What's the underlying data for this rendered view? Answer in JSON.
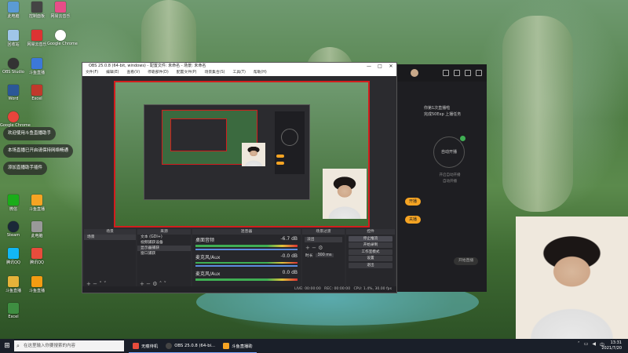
{
  "desktop": {
    "icons": [
      {
        "label": "此电脑",
        "color": "#5b9bd5"
      },
      {
        "label": "回收站",
        "color": "#9fc5e8"
      },
      {
        "label": "OBS Studio",
        "color": "#333"
      },
      {
        "label": "控制面板",
        "color": "#4a86e8"
      },
      {
        "label": "斗鱼直播",
        "color": "#f6a423"
      },
      {
        "label": "Excel",
        "color": "#1d7044"
      },
      {
        "label": "Word",
        "color": "#2b5797"
      },
      {
        "label": "Google Chrome",
        "color": "#e8453c"
      },
      {
        "label": "微信",
        "color": "#1aad19"
      },
      {
        "label": "Steam",
        "color": "#1b2838"
      },
      {
        "label": "腾讯QQ",
        "color": "#12b7f5"
      },
      {
        "label": "网易云音乐",
        "color": "#c20c0c"
      }
    ],
    "notifications": [
      "欢迎使用斗鱼直播助手",
      "本场直播已开启请保持网络畅通",
      "添加直播助手插件"
    ]
  },
  "douyu": {
    "title": "斗鱼直播助手",
    "room_info_line1": "你第1次直播啦",
    "room_info_line2": "完成50Exp 上播任务",
    "action_label": "自动开播",
    "sub_label_1": "开启自动开播",
    "sub_label_2": "自动开播",
    "button_1": "开播",
    "button_2": "关播",
    "footer_button": "开始直播"
  },
  "obs": {
    "title": "OBS 25.0.8 (64-bit, windows) - 配置文件: 未命名 - 场景: 未命名",
    "window_controls": [
      "—",
      "□",
      "✕"
    ],
    "menu": [
      "文件(F)",
      "编辑(E)",
      "查看(V)",
      "停靠部件(D)",
      "配置文件(P)",
      "场景集合(S)",
      "工具(T)",
      "帮助(H)"
    ],
    "docks": {
      "scenes": {
        "title": "场景",
        "items": [
          "场景"
        ]
      },
      "sources": {
        "title": "来源",
        "items": [
          "文本 (GDI+)",
          "视频捕获设备",
          "显示器捕获",
          "窗口捕获"
        ]
      },
      "mixer": {
        "title": "混音器",
        "channels": [
          {
            "name": "桌面音频",
            "db": "-6.7 dB"
          },
          {
            "name": "麦克风/Aux",
            "db": "-0.0 dB"
          },
          {
            "name": "麦克风/Aux",
            "db": "0.0 dB"
          }
        ]
      },
      "transitions": {
        "title": "场景过渡",
        "type": "淡出",
        "duration_label": "时长",
        "duration": "300 ms"
      },
      "controls": {
        "title": "控件",
        "buttons": [
          "停止推流",
          "开始录制",
          "工作室模式",
          "设置",
          "退出"
        ]
      }
    },
    "status": {
      "live": "LIVE: 00:00:00",
      "rec": "REC: 00:00:00",
      "cpu": "CPU: 1.4%, 30.00 fps"
    }
  },
  "taskbar": {
    "search_placeholder": "在这里输入你要搜索的内容",
    "apps": [
      {
        "label": "无痕待机",
        "color": "#e74c3c"
      },
      {
        "label": "OBS 25.0.8 (64-bi...",
        "color": "#444"
      },
      {
        "label": "斗鱼直播助",
        "color": "#f6a423"
      }
    ],
    "time": "13:31",
    "date": "2021/7/20"
  }
}
